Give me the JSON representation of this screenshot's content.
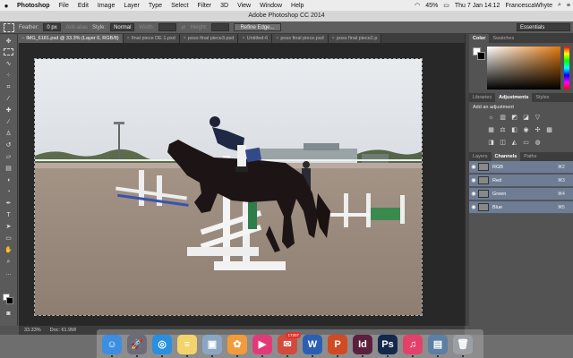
{
  "menubar": {
    "apple": "",
    "app_name": "Photoshop",
    "items": [
      "File",
      "Edit",
      "Image",
      "Layer",
      "Type",
      "Select",
      "Filter",
      "3D",
      "View",
      "Window",
      "Help"
    ],
    "battery": "45%",
    "clock": "Thu 7 Jan 14:12",
    "user": "FrancescaWhyte"
  },
  "window": {
    "title": "Adobe Photoshop CC 2014"
  },
  "options": {
    "feather_label": "Feather:",
    "feather_value": "0 px",
    "anti_alias": "Anti-alias",
    "style_label": "Style:",
    "style_value": "Normal",
    "width_label": "Width:",
    "height_label": "Height:",
    "refine_edge": "Refine Edge...",
    "workspace": "Essentials"
  },
  "tabs": [
    {
      "label": "IMG_6181.psd @ 33.3% (Layer 0, RGB/8)",
      "active": true
    },
    {
      "label": "final piece DE 1.psd",
      "active": false
    },
    {
      "label": "poss final piece3.psd",
      "active": false
    },
    {
      "label": "Untitled-6",
      "active": false
    },
    {
      "label": "poss final piece.psd",
      "active": false
    },
    {
      "label": "poss final piece2.p",
      "active": false
    }
  ],
  "status": {
    "zoom": "33.33%",
    "doc": "Doc: 61.9M/"
  },
  "color_panel": {
    "tabs": [
      "Color",
      "Swatches"
    ]
  },
  "adjust_panel": {
    "tabs": [
      "Libraries",
      "Adjustments",
      "Styles"
    ],
    "title": "Add an adjustment"
  },
  "channels_panel": {
    "tabs": [
      "Layers",
      "Channels",
      "Paths"
    ],
    "rows": [
      {
        "name": "RGB",
        "shortcut": "⌘2"
      },
      {
        "name": "Red",
        "shortcut": "⌘3"
      },
      {
        "name": "Green",
        "shortcut": "⌘4"
      },
      {
        "name": "Blue",
        "shortcut": "⌘5"
      }
    ]
  },
  "dock": {
    "apps": [
      {
        "name": "finder",
        "glyph": "☺",
        "color": "#3d8ee0"
      },
      {
        "name": "launchpad",
        "glyph": "🚀",
        "color": "#6b6b7a"
      },
      {
        "name": "safari",
        "glyph": "◎",
        "color": "#2a8fe0"
      },
      {
        "name": "notes",
        "glyph": "≡",
        "color": "#f3d36b"
      },
      {
        "name": "preview",
        "glyph": "▣",
        "color": "#8aa6c4"
      },
      {
        "name": "photos",
        "glyph": "✿",
        "color": "#f29b3a"
      },
      {
        "name": "itunes-remote",
        "glyph": "▶",
        "color": "#e23a78"
      },
      {
        "name": "mail-badge",
        "glyph": "✉",
        "color": "#d34b3d",
        "badge": "17207"
      },
      {
        "name": "word",
        "glyph": "W",
        "color": "#2b5fb4"
      },
      {
        "name": "powerpoint",
        "glyph": "P",
        "color": "#d04a23"
      },
      {
        "name": "indesign",
        "glyph": "Id",
        "color": "#5c1f3d"
      },
      {
        "name": "photoshop",
        "glyph": "Ps",
        "color": "#13284b"
      },
      {
        "name": "music",
        "glyph": "♫",
        "color": "#e4416a"
      },
      {
        "name": "image-capture",
        "glyph": "▤",
        "color": "#5b7fa5"
      },
      {
        "name": "trash",
        "glyph": "🗑",
        "color": "#9aa0a6"
      }
    ]
  }
}
